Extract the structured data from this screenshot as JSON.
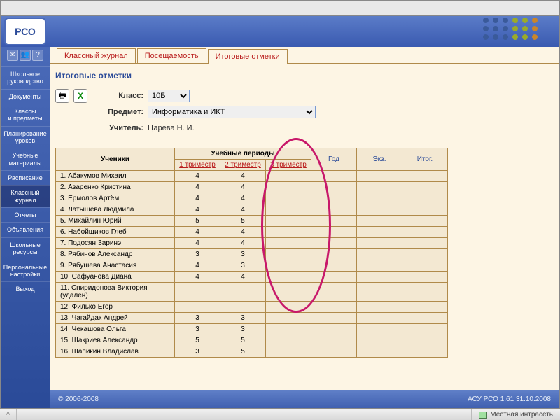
{
  "logo": "РСО",
  "sidebar": {
    "items": [
      {
        "label": "Школьное\nруководство"
      },
      {
        "label": "Документы"
      },
      {
        "label": "Классы\nи предметы"
      },
      {
        "label": "Планирование\nуроков"
      },
      {
        "label": "Учебные\nматериалы"
      },
      {
        "label": "Расписание"
      },
      {
        "label": "Классный\nжурнал"
      },
      {
        "label": "Отчеты"
      },
      {
        "label": "Объявления"
      },
      {
        "label": "Школьные\nресурсы"
      },
      {
        "label": "Персональные\nнастройки"
      },
      {
        "label": "Выход"
      }
    ]
  },
  "tabs": [
    {
      "label": "Классный журнал"
    },
    {
      "label": "Посещаемость"
    },
    {
      "label": "Итоговые отметки"
    }
  ],
  "page_title": "Итоговые отметки",
  "form": {
    "class_label": "Класс:",
    "class_value": "10Б",
    "subject_label": "Предмет:",
    "subject_value": "Информатика и ИКТ",
    "teacher_label": "Учитель:",
    "teacher_value": "Царева Н. И."
  },
  "table": {
    "students_header": "Ученики",
    "periods_header": "Учебные периоды",
    "trimesters": [
      "1 триместр",
      "2 триместр",
      "3 триместр"
    ],
    "extras": [
      "Год",
      "Экз.",
      "Итог."
    ],
    "rows": [
      {
        "n": "1",
        "name": "Абакумов Михаил",
        "g": [
          "4",
          "4",
          "",
          "",
          "",
          ""
        ]
      },
      {
        "n": "2",
        "name": "Азаренко Кристина",
        "g": [
          "4",
          "4",
          "",
          "",
          "",
          ""
        ]
      },
      {
        "n": "3",
        "name": "Ермолов Артём",
        "g": [
          "4",
          "4",
          "",
          "",
          "",
          ""
        ]
      },
      {
        "n": "4",
        "name": "Латышева Людмила",
        "g": [
          "4",
          "4",
          "",
          "",
          "",
          ""
        ]
      },
      {
        "n": "5",
        "name": "Михайлин Юрий",
        "g": [
          "5",
          "5",
          "",
          "",
          "",
          ""
        ]
      },
      {
        "n": "6",
        "name": "Набойщиков Глеб",
        "g": [
          "4",
          "4",
          "",
          "",
          "",
          ""
        ]
      },
      {
        "n": "7",
        "name": "Подосян Заринэ",
        "g": [
          "4",
          "4",
          "",
          "",
          "",
          ""
        ]
      },
      {
        "n": "8",
        "name": "Рябинов Александр",
        "g": [
          "3",
          "3",
          "",
          "",
          "",
          ""
        ]
      },
      {
        "n": "9",
        "name": "Рябушева Анастасия",
        "g": [
          "4",
          "3",
          "",
          "",
          "",
          ""
        ]
      },
      {
        "n": "10",
        "name": "Сафуанова Диана",
        "g": [
          "4",
          "4",
          "",
          "",
          "",
          ""
        ]
      },
      {
        "n": "11",
        "name": "Спиридонова Виктория (удалён)",
        "g": [
          "",
          "",
          "",
          "",
          "",
          ""
        ]
      },
      {
        "n": "12",
        "name": "Филько Егор",
        "g": [
          "",
          "",
          "",
          "",
          "",
          ""
        ]
      },
      {
        "n": "13",
        "name": "Чагайдак Андрей",
        "g": [
          "3",
          "3",
          "",
          "",
          "",
          ""
        ]
      },
      {
        "n": "14",
        "name": "Чекашова Ольга",
        "g": [
          "3",
          "3",
          "",
          "",
          "",
          ""
        ]
      },
      {
        "n": "15",
        "name": "Шакриев Александр",
        "g": [
          "5",
          "5",
          "",
          "",
          "",
          ""
        ]
      },
      {
        "n": "16",
        "name": "Шапикин Владислав",
        "g": [
          "3",
          "5",
          "",
          "",
          "",
          ""
        ]
      }
    ]
  },
  "footer": {
    "copyright": "© 2006-2008",
    "version": "АСУ РСО 1.61   31.10.2008"
  },
  "statusbar": {
    "zone": "Местная интрасеть"
  }
}
